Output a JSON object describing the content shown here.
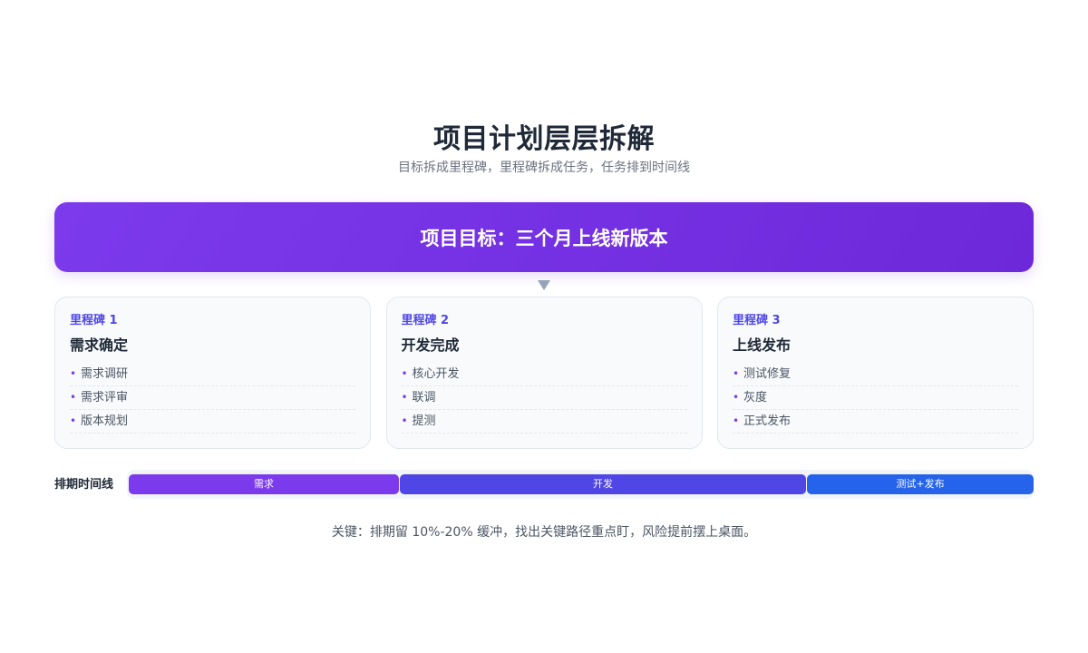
{
  "header": {
    "title": "项目计划层层拆解",
    "subtitle": "目标拆成里程碑，里程碑拆成任务，任务排到时间线"
  },
  "goal": {
    "text": "项目目标：三个月上线新版本"
  },
  "milestones": [
    {
      "label": "里程碑 1",
      "title": "需求确定",
      "tasks": [
        "需求调研",
        "需求评审",
        "版本规划"
      ]
    },
    {
      "label": "里程碑 2",
      "title": "开发完成",
      "tasks": [
        "核心开发",
        "联调",
        "提测"
      ]
    },
    {
      "label": "里程碑 3",
      "title": "上线发布",
      "tasks": [
        "测试修复",
        "灰度",
        "正式发布"
      ]
    }
  ],
  "timeline": {
    "label": "排期时间线",
    "segments": [
      {
        "label": "需求",
        "share": 0.3,
        "color": "#7c3aed"
      },
      {
        "label": "开发",
        "share": 0.45,
        "color": "#4f46e5"
      },
      {
        "label": "测试+发布",
        "share": 0.25,
        "color": "#2563eb"
      }
    ]
  },
  "note": "关键：排期留 10%-20% 缓冲，找出关键路径重点盯，风险提前摆上桌面。",
  "colors": {
    "accent": "#7c3aed",
    "goal_gradient_end": "#6d28d9",
    "milestone_label": "#4f46e5"
  }
}
